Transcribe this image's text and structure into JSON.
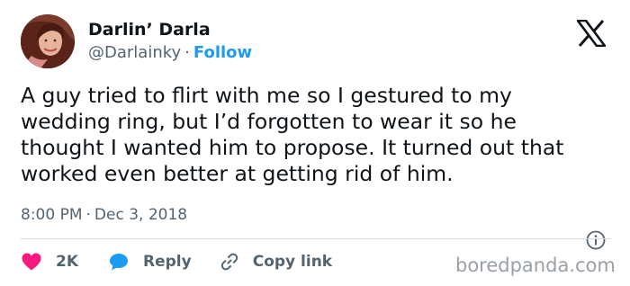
{
  "author": {
    "name": "Darlin’ Darla",
    "handle": "@Darlainky",
    "separator": "·",
    "follow_label": "Follow"
  },
  "tweet": {
    "text": "A guy tried to flirt with me so I gestured to my wedding ring, but I’d forgotten to wear it so he thought I wanted him to propose. It turned out that worked even better at getting rid of him.",
    "time": "8:00 PM",
    "date_separator": "·",
    "date": "Dec 3, 2018"
  },
  "actions": {
    "likes_count": "2K",
    "reply_label": "Reply",
    "copy_link_label": "Copy link"
  },
  "watermark": "boredpanda.com",
  "icons": {
    "logo": "x-logo-icon",
    "info": "info-icon",
    "like": "heart-icon",
    "reply": "speech-bubble-icon",
    "copy": "link-icon"
  },
  "colors": {
    "text": "#0f1419",
    "secondary": "#536471",
    "link": "#1d9bf0",
    "heart": "#f91880",
    "reply_bubble": "#1d9bf0",
    "divider": "#cfd9de"
  }
}
